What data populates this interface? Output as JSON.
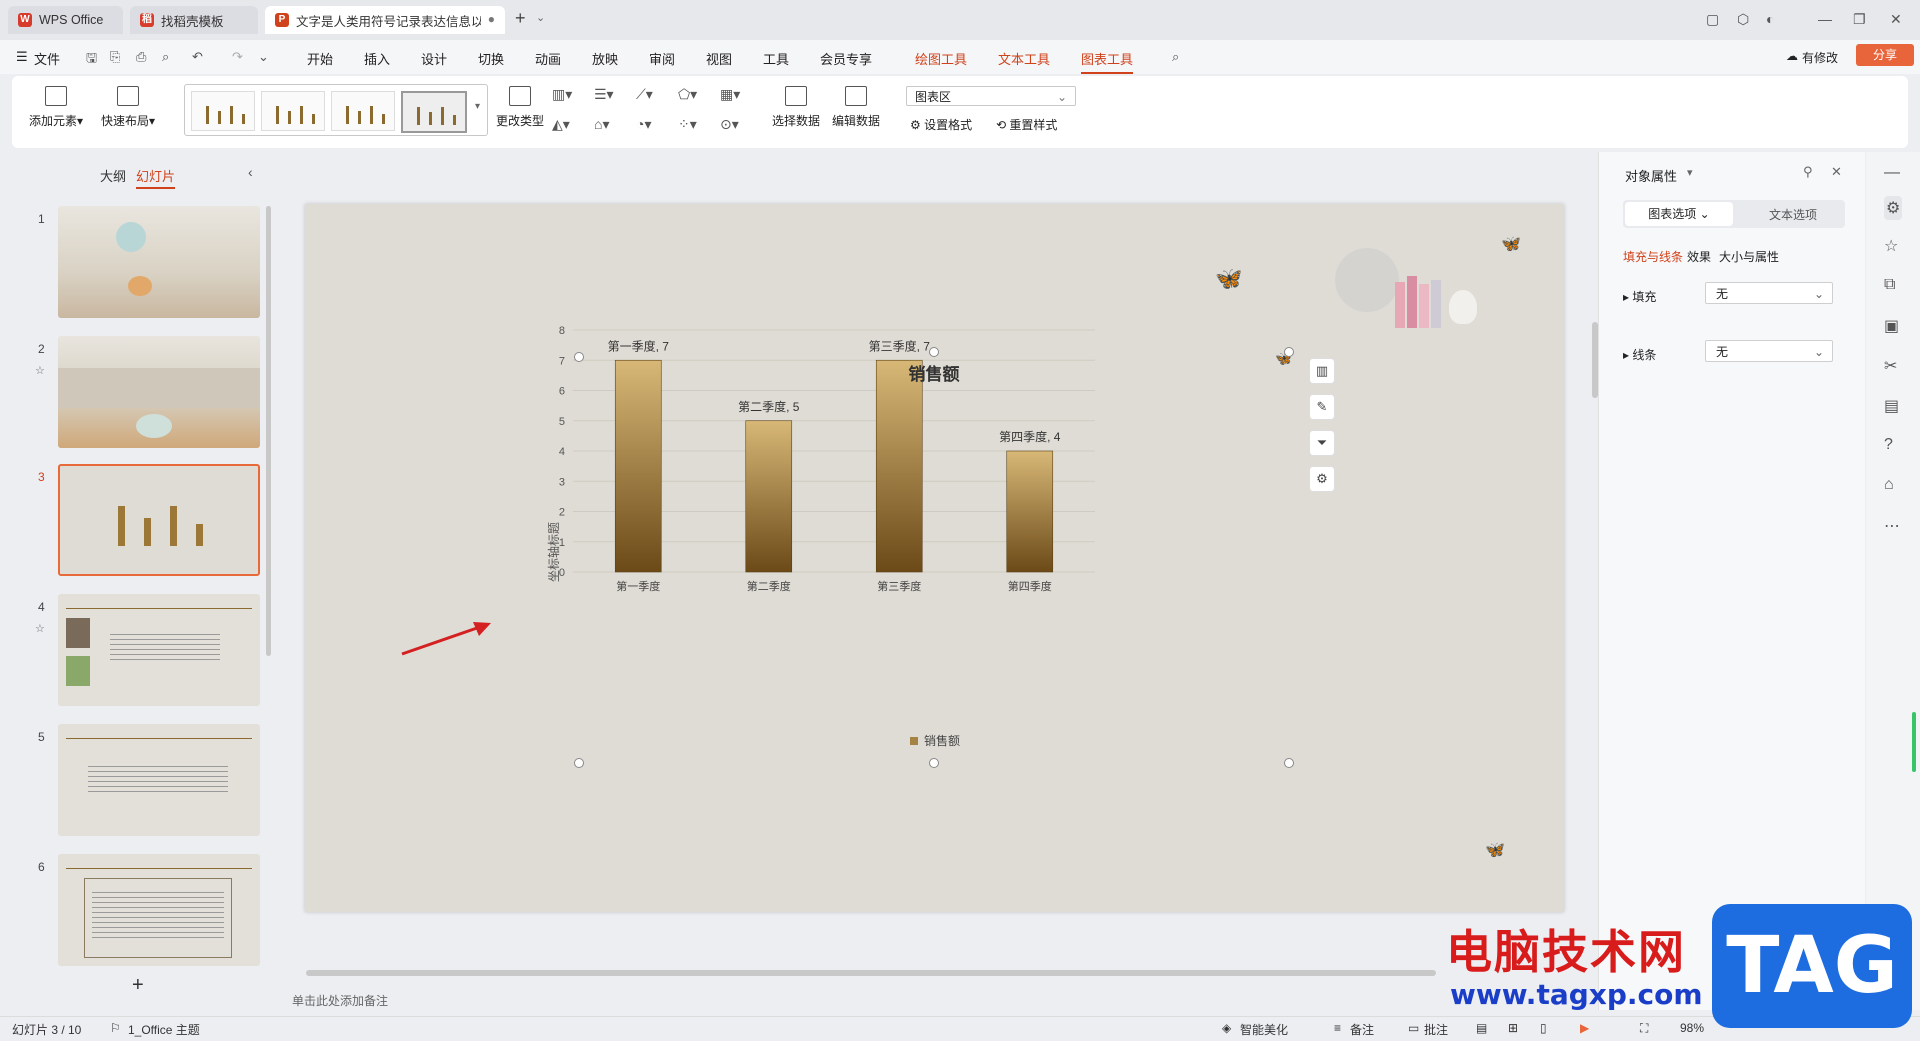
{
  "titlebar": {
    "tabs": [
      {
        "label": "WPS Office"
      },
      {
        "label": "找稻壳模板"
      },
      {
        "label": "文字是人类用符号记录表达信息以"
      }
    ],
    "new_tab": "+"
  },
  "menu": {
    "file": "文件",
    "items": [
      "开始",
      "插入",
      "设计",
      "切换",
      "动画",
      "放映",
      "审阅",
      "视图",
      "工具",
      "会员专享"
    ],
    "context_items": [
      "绘图工具",
      "文本工具",
      "图表工具"
    ],
    "has_changes": "有修改",
    "share": "分享"
  },
  "ribbon": {
    "add_element": "添加元素",
    "quick_layout": "快速布局",
    "change_type": "更改类型",
    "select_data": "选择数据",
    "edit_data": "编辑数据",
    "chart_area_select": "图表区",
    "set_format": "设置格式",
    "reset_style": "重置样式"
  },
  "left_panel": {
    "tab_outline": "大纲",
    "tab_slides": "幻灯片",
    "slide_numbers": [
      "1",
      "2",
      "3",
      "4",
      "5",
      "6"
    ],
    "add_slide": "+"
  },
  "chart_data": {
    "type": "bar",
    "title": "销售额",
    "categories": [
      "第一季度",
      "第二季度",
      "第三季度",
      "第四季度"
    ],
    "values": [
      7,
      5,
      7,
      4
    ],
    "data_labels": [
      "第一季度, 7",
      "第二季度, 5",
      "第三季度, 7",
      "第四季度, 4"
    ],
    "ylabel": "坐标轴标题",
    "ylim": [
      0,
      8
    ],
    "yticks": [
      "0",
      "1",
      "2",
      "3",
      "4",
      "5",
      "6",
      "7",
      "8"
    ],
    "legend": "销售额",
    "legend_position": "bottom",
    "grid": true,
    "bar_color_top": "#d8b877",
    "bar_color_bottom": "#6b4a18"
  },
  "right_pane": {
    "title": "对象属性",
    "tab_chart_options": "图表选项",
    "tab_text_options": "文本选项",
    "sub_fill_line": "填充与线条",
    "sub_effect": "效果",
    "sub_size": "大小与属性",
    "fill_label": "填充",
    "fill_value": "无",
    "line_label": "线条",
    "line_value": "无"
  },
  "notes_placeholder": "单击此处添加备注",
  "status": {
    "slide_info": "幻灯片 3 / 10",
    "theme": "1_Office 主题",
    "smart_beautify": "智能美化",
    "notes": "备注",
    "comments": "批注",
    "zoom": "98%"
  },
  "watermark": {
    "cn": "电脑技术网",
    "url": "www.tagxp.com",
    "tag": "TAG"
  },
  "colors": {
    "accent": "#d0421b",
    "share_bg": "#e8643a",
    "slide_bg": "#dfdcd5",
    "arrow": "#d42020"
  }
}
